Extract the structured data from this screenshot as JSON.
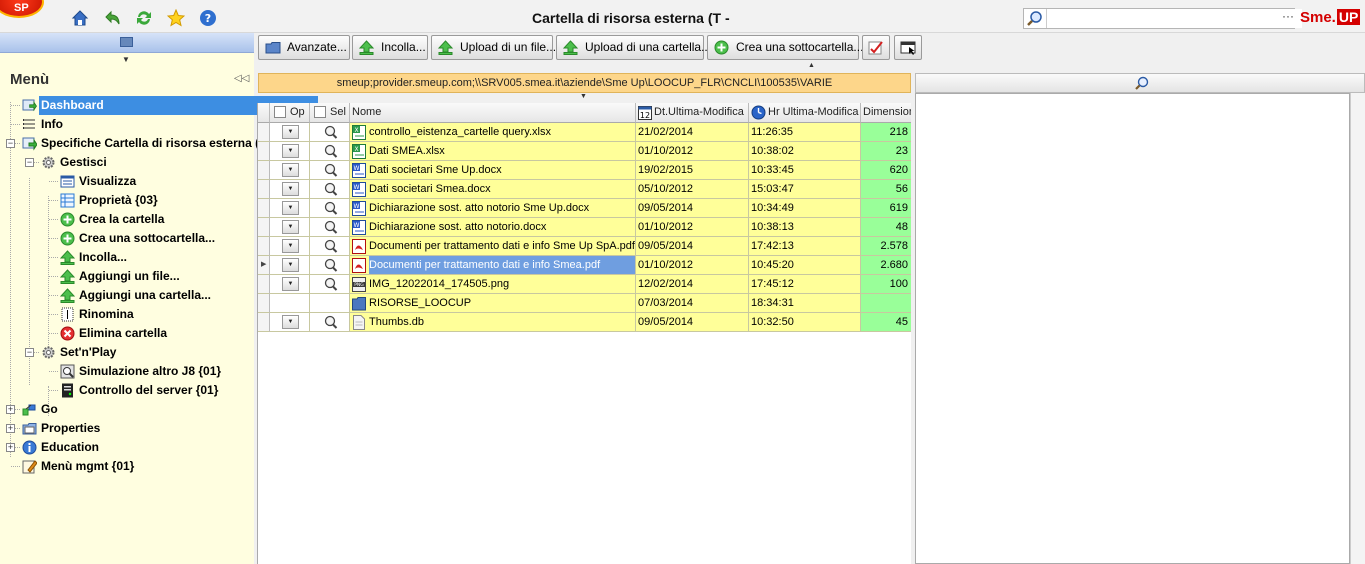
{
  "app": {
    "title": "Cartella di risorsa esterna (T -",
    "brand_sme": "Sme.",
    "brand_up": "UP",
    "logo_text": "SP"
  },
  "topbar_icons": [
    "home-icon",
    "back-icon",
    "refresh-icon",
    "star-icon",
    "help-icon"
  ],
  "search": {
    "value": "",
    "more": "···"
  },
  "menu": {
    "title": "Menù",
    "items": [
      {
        "label": "Dashboard",
        "icon": "dashboard-icon",
        "selected": true
      },
      {
        "label": "Info",
        "icon": "info-list-icon"
      },
      {
        "label": "Specifiche Cartella di risorsa esterna (",
        "icon": "specs-icon"
      },
      {
        "label": "Gestisci",
        "icon": "gear-icon"
      },
      {
        "label": "Visualizza",
        "icon": "view-icon"
      },
      {
        "label": "Proprietà {03}",
        "icon": "properties-icon"
      },
      {
        "label": "Crea la cartella",
        "icon": "add-icon"
      },
      {
        "label": "Crea una sottocartella...",
        "icon": "add-icon"
      },
      {
        "label": "Incolla...",
        "icon": "upload-icon"
      },
      {
        "label": "Aggiungi un file...",
        "icon": "upload-icon"
      },
      {
        "label": "Aggiungi una cartella...",
        "icon": "upload-icon"
      },
      {
        "label": "Rinomina",
        "icon": "rename-icon"
      },
      {
        "label": "Elimina cartella",
        "icon": "delete-icon"
      },
      {
        "label": "Set'n'Play",
        "icon": "gear-icon"
      },
      {
        "label": "Simulazione altro J8 {01}",
        "icon": "simulation-icon"
      },
      {
        "label": "Controllo del server {01}",
        "icon": "server-icon"
      },
      {
        "label": "Go",
        "icon": "go-icon"
      },
      {
        "label": "Properties",
        "icon": "folder-properties-icon"
      },
      {
        "label": "Education",
        "icon": "education-icon"
      },
      {
        "label": "Menù mgmt {01}",
        "icon": "menu-mgmt-icon"
      }
    ]
  },
  "toolbar": {
    "buttons": [
      {
        "label": "Avanzate...",
        "icon": "folder-icon"
      },
      {
        "label": "Incolla...",
        "icon": "upload-icon"
      },
      {
        "label": "Upload di un file...",
        "icon": "upload-icon"
      },
      {
        "label": "Upload di una cartella...",
        "icon": "upload-icon"
      },
      {
        "label": "Crea una sottocartella...",
        "icon": "add-icon"
      }
    ]
  },
  "path": "smeup;provider.smeup.com;\\\\SRV005.smea.it\\aziende\\Sme Up\\LOOCUP_FLR\\CNCLI\\100535\\VARIE",
  "grid": {
    "columns": {
      "op": "Op",
      "sel": "Sel",
      "name": "Nome",
      "date": "Dt.Ultima-Modifica",
      "time": "Hr Ultima-Modifica",
      "size": "Dimension"
    },
    "rows": [
      {
        "name": "controllo_eistenza_cartelle query.xlsx",
        "type": "excel",
        "date": "21/02/2014",
        "time": "11:26:35",
        "size": "218"
      },
      {
        "name": "Dati SMEA.xlsx",
        "type": "excel",
        "date": "01/10/2012",
        "time": "10:38:02",
        "size": "23"
      },
      {
        "name": "Dati societari Sme Up.docx",
        "type": "word",
        "date": "19/02/2015",
        "time": "10:33:45",
        "size": "620"
      },
      {
        "name": "Dati societari Smea.docx",
        "type": "word",
        "date": "05/10/2012",
        "time": "15:03:47",
        "size": "56"
      },
      {
        "name": "Dichiarazione sost. atto notorio Sme Up.docx",
        "type": "word",
        "date": "09/05/2014",
        "time": "10:34:49",
        "size": "619"
      },
      {
        "name": "Dichiarazione sost. atto notorio.docx",
        "type": "word",
        "date": "01/10/2012",
        "time": "10:38:13",
        "size": "48"
      },
      {
        "name": "Documenti per trattamento dati e info Sme Up SpA.pdf",
        "type": "pdf",
        "date": "09/05/2014",
        "time": "17:42:13",
        "size": "2.578"
      },
      {
        "name": "Documenti per trattamento dati e info Smea.pdf",
        "type": "pdf",
        "date": "01/10/2012",
        "time": "10:45:20",
        "size": "2.680",
        "selected": true
      },
      {
        "name": "IMG_12022014_174505.png",
        "type": "image",
        "date": "12/02/2014",
        "time": "17:45:12",
        "size": "100"
      },
      {
        "name": "RISORSE_LOOCUP",
        "type": "folder",
        "date": "07/03/2014",
        "time": "18:34:31",
        "size": ""
      },
      {
        "name": "Thumbs.db",
        "type": "file",
        "date": "09/05/2014",
        "time": "10:32:50",
        "size": "45"
      }
    ]
  },
  "colors": {
    "selection": "#3d8ee2",
    "row_yellow": "#ffff99",
    "size_green": "#99ff99",
    "path_bar": "#fdd68a",
    "menu_bg": "#fffee0"
  }
}
